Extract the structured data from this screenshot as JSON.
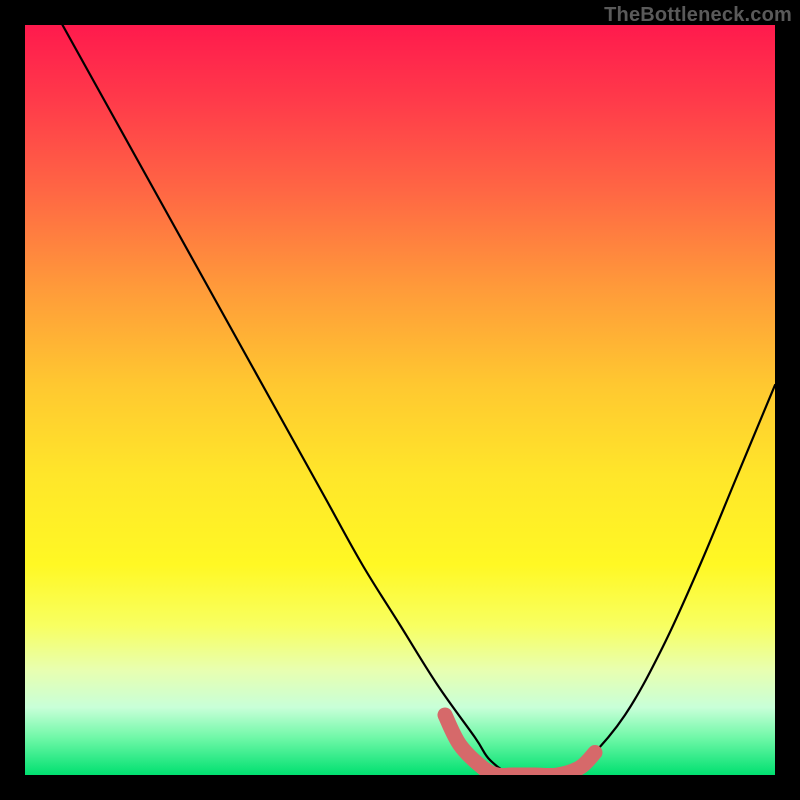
{
  "watermark": "TheBottleneck.com",
  "chart_data": {
    "type": "line",
    "title": "",
    "xlabel": "",
    "ylabel": "",
    "xlim": [
      0,
      100
    ],
    "ylim": [
      0,
      100
    ],
    "series": [
      {
        "name": "bottleneck-curve",
        "x": [
          5,
          10,
          15,
          20,
          25,
          30,
          35,
          40,
          45,
          50,
          55,
          60,
          62,
          65,
          68,
          72,
          75,
          80,
          85,
          90,
          95,
          100
        ],
        "values": [
          100,
          91,
          82,
          73,
          64,
          55,
          46,
          37,
          28,
          20,
          12,
          5,
          2,
          0,
          0,
          0,
          2,
          8,
          17,
          28,
          40,
          52
        ]
      }
    ],
    "annotations": [
      {
        "name": "highlight-trough",
        "color": "#d6696a",
        "x": [
          56,
          58,
          61,
          63,
          65,
          68,
          71,
          74,
          76
        ],
        "values": [
          8,
          4,
          1,
          0,
          0,
          0,
          0,
          1,
          3
        ]
      }
    ]
  }
}
